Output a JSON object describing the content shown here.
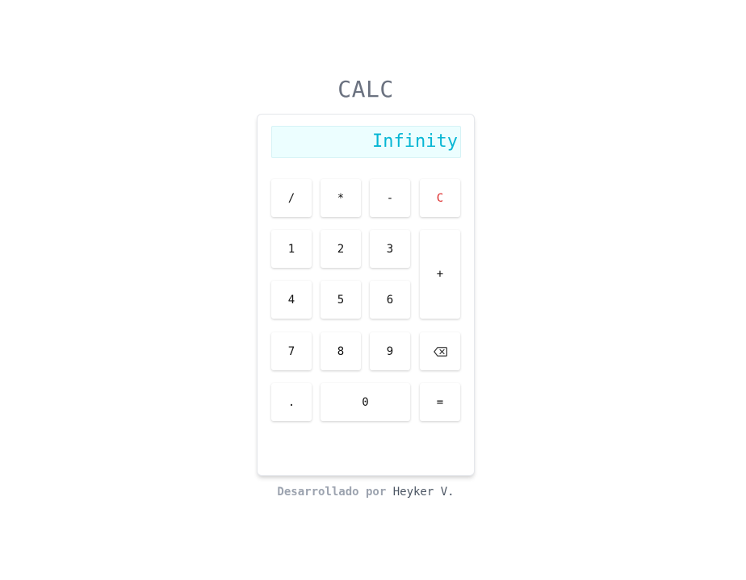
{
  "app": {
    "title": "CALC"
  },
  "display": {
    "value": "Infinity",
    "color": "#06b6d4",
    "background": "#ecfeff"
  },
  "keys": {
    "divide": "/",
    "multiply": "*",
    "subtract": "-",
    "clear": "C",
    "one": "1",
    "two": "2",
    "three": "3",
    "add": "+",
    "four": "4",
    "five": "5",
    "six": "6",
    "seven": "7",
    "eight": "8",
    "nine": "9",
    "backspace_icon": "backspace-icon",
    "decimal": ".",
    "zero": "0",
    "equals": "="
  },
  "footer": {
    "prefix": "Desarrollado por",
    "author": "Heyker V."
  },
  "colors": {
    "clear_key": "#dc2626",
    "title": "#6b7280"
  }
}
